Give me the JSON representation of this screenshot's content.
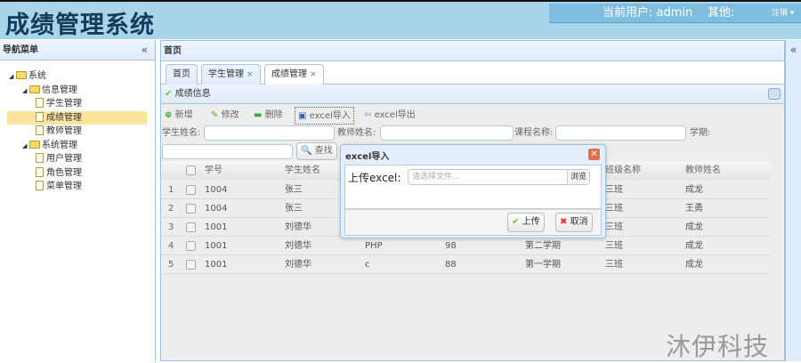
{
  "header": {
    "title": "成绩管理系统",
    "current_user_label": "当前用户: admin",
    "other_label": "其他:",
    "logout": "注销 ▾"
  },
  "sidebar": {
    "title": "导航菜单",
    "collapse": "«",
    "items": [
      {
        "label": "系统",
        "type": "folder",
        "level": 0
      },
      {
        "label": "信息管理",
        "type": "folder",
        "level": 1
      },
      {
        "label": "学生管理",
        "type": "file",
        "level": 2
      },
      {
        "label": "成绩管理",
        "type": "file",
        "level": 2,
        "selected": true
      },
      {
        "label": "教师管理",
        "type": "file",
        "level": 2
      },
      {
        "label": "系统管理",
        "type": "folder",
        "level": 1
      },
      {
        "label": "用户管理",
        "type": "file",
        "level": 2
      },
      {
        "label": "角色管理",
        "type": "file",
        "level": 2
      },
      {
        "label": "菜单管理",
        "type": "file",
        "level": 2
      }
    ]
  },
  "main": {
    "title": "首页",
    "tabs": [
      {
        "label": "首页"
      },
      {
        "label": "学生管理",
        "close": "×"
      },
      {
        "label": "成绩管理",
        "close": "×"
      }
    ],
    "panel_title": "成绩信息",
    "toolbar": {
      "add": "新增",
      "edit": "修改",
      "delete": "删除",
      "import": "excel导入",
      "export": "excel导出"
    },
    "search": {
      "student_name": "学生姓名:",
      "teacher_name": "教师姓名:",
      "course_name": "课程名称:",
      "semester": "学期:",
      "find": "查找"
    },
    "columns": [
      "学号",
      "学生姓名",
      "",
      "",
      "",
      "班级名称",
      "教师姓名"
    ],
    "rows": [
      {
        "n": "1",
        "id": "1004",
        "name": "张三",
        "course": "",
        "score": "",
        "term": "",
        "cls": "三班",
        "teacher": "成龙"
      },
      {
        "n": "2",
        "id": "1004",
        "name": "张三",
        "course": "",
        "score": "",
        "term": "",
        "cls": "三班",
        "teacher": "王勇"
      },
      {
        "n": "3",
        "id": "1001",
        "name": "刘德华",
        "course": "",
        "score": "",
        "term": "",
        "cls": "三班",
        "teacher": "成龙"
      },
      {
        "n": "4",
        "id": "1001",
        "name": "刘德华",
        "course": "PHP",
        "score": "98",
        "term": "第二学期",
        "cls": "三班",
        "teacher": "成龙"
      },
      {
        "n": "5",
        "id": "1001",
        "name": "刘德华",
        "course": "c",
        "score": "88",
        "term": "第一学期",
        "cls": "三班",
        "teacher": "成龙"
      }
    ]
  },
  "dialog": {
    "title": "excel导入",
    "label": "上传excel:",
    "placeholder": "请选择文件...",
    "browse": "浏览",
    "upload": "上传",
    "cancel": "取消"
  },
  "right_collapse": "«",
  "watermark": "沐伊科技"
}
